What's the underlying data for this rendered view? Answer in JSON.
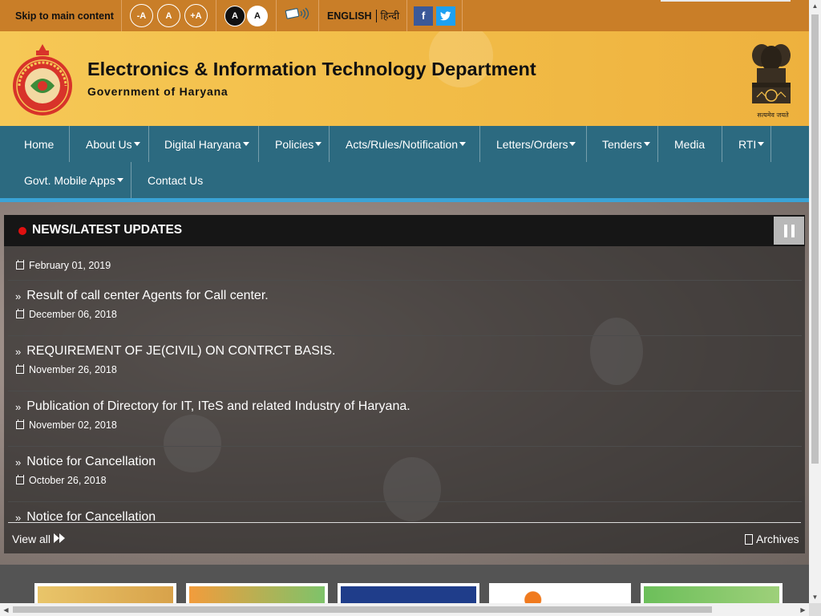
{
  "topbar": {
    "skip_label": "Skip to main content",
    "font_decrease": "-A",
    "font_normal": "A",
    "font_increase": "+A",
    "contrast_dark": "A",
    "contrast_light": "A",
    "lang_english": "ENGLISH",
    "lang_hindi": "हिन्दी",
    "facebook_glyph": "f",
    "twitter_glyph": "t"
  },
  "header": {
    "title": "Electronics & Information Technology Department",
    "subtitle": "Government of Haryana",
    "emblem_motto": "सत्यमेव जयते"
  },
  "nav": {
    "row1": [
      {
        "label": "Home",
        "dropdown": false
      },
      {
        "label": "About Us",
        "dropdown": true
      },
      {
        "label": "Digital Haryana",
        "dropdown": true
      },
      {
        "label": "Policies",
        "dropdown": true
      },
      {
        "label": "Acts/Rules/Notification",
        "dropdown": true
      },
      {
        "label": "Letters/Orders",
        "dropdown": true
      },
      {
        "label": "Tenders",
        "dropdown": true
      },
      {
        "label": "Media",
        "dropdown": false
      },
      {
        "label": "RTI",
        "dropdown": true
      }
    ],
    "row2": [
      {
        "label": "Govt. Mobile Apps",
        "dropdown": true
      },
      {
        "label": "Contact Us",
        "dropdown": false
      }
    ]
  },
  "news": {
    "title": "NEWS/LATEST UPDATES",
    "items": [
      {
        "headline": "",
        "date": "February 01, 2019"
      },
      {
        "headline": "Result of call center Agents for Call center.",
        "date": "December 06, 2018"
      },
      {
        "headline": "REQUIREMENT OF JE(CIVIL) ON CONTRCT BASIS.",
        "date": "November 26, 2018"
      },
      {
        "headline": "Publication of Directory for IT, ITeS and related Industry of Haryana.",
        "date": "November 02, 2018"
      },
      {
        "headline": "Notice for Cancellation",
        "date": "October 26, 2018"
      },
      {
        "headline": "Notice for Cancellation",
        "date": ""
      }
    ],
    "view_all_label": "View all",
    "archives_label": "Archives"
  },
  "colors": {
    "topbar": "#c97e28",
    "header": "#f2bd48",
    "nav": "#216881",
    "accent": "#3aa3d6",
    "live_dot": "#e01010"
  }
}
